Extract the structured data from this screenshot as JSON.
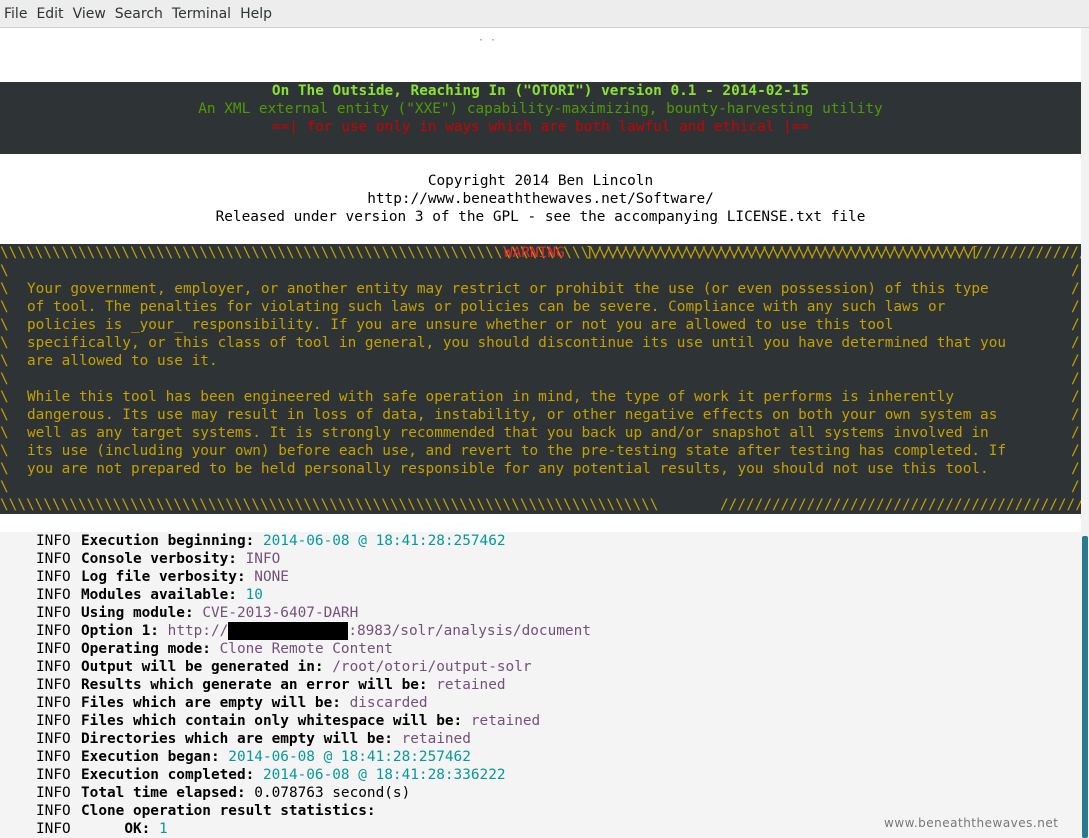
{
  "menu": [
    "File",
    "Edit",
    "View",
    "Search",
    "Terminal",
    "Help"
  ],
  "banner": {
    "title": "On The Outside, Reaching In (\"OTORI\") version 0.1 - 2014-02-15",
    "subtitle": "An XML external entity (\"XXE\") capability-maximizing, bounty-harvesting utility",
    "notice": "==| for use only in ways which are both lawful and ethical |=="
  },
  "copyright": {
    "line1": "Copyright 2014 Ben Lincoln",
    "line2": "http://www.beneaththewaves.net/Software/",
    "line3": "Released under version 3 of the GPL - see the accompanying LICENSE.txt file"
  },
  "warning": {
    "title": "WARNING",
    "para1": [
      "Your government, employer, or another entity may restrict or prohibit the use (or even possession) of this type",
      "of tool. The penalties for violating such laws or policies can be severe. Compliance with any such laws or",
      "policies is _your_ responsibility. If you are unsure whether or not you are allowed to use this tool",
      "specifically, or this class of tool in general, you should discontinue its use until you have determined that you",
      "are allowed to use it."
    ],
    "para2": [
      "While this tool has been engineered with safe operation in mind, the type of work it performs is inherently",
      "dangerous. Its use may result in loss of data, instability, or other negative effects on both your own system as",
      "well as any target systems. It is strongly recommended that you back up and/or snapshot all systems involved in",
      "its use (including your own) before each use, and revert to the pre-testing state after testing has completed. If",
      "you are not prepared to be held personally responsible for any potential results, you should not use this tool."
    ]
  },
  "log": {
    "level": "INFO",
    "rows": [
      {
        "label": "Execution beginning:",
        "value": "2014-06-08 @ 18:41:28:257462",
        "color": "teal"
      },
      {
        "label": "Console verbosity:",
        "value": "INFO",
        "color": "purple"
      },
      {
        "label": "Log file verbosity:",
        "value": "NONE",
        "color": "purple"
      },
      {
        "label": "Modules available:",
        "value": "10",
        "color": "teal"
      },
      {
        "label": "Using module:",
        "value": "CVE-2013-6407-DARH",
        "color": "purple"
      },
      {
        "label": "Option 1:",
        "value_prefix": "http://",
        "value_suffix": ":8983/solr/analysis/document",
        "color": "purple"
      },
      {
        "label": "Operating mode:",
        "value": "Clone Remote Content",
        "color": "purple"
      },
      {
        "label": "Output will be generated in:",
        "value": "/root/otori/output-solr",
        "color": "purple"
      },
      {
        "label": "Results which generate an error will be:",
        "value": "retained",
        "color": "purple"
      },
      {
        "label": "Files which are empty will be:",
        "value": "discarded",
        "color": "purple"
      },
      {
        "label": "Files which contain only whitespace will be:",
        "value": "retained",
        "color": "purple"
      },
      {
        "label": "Directories which are empty will be:",
        "value": "retained",
        "color": "purple"
      },
      {
        "label": "Execution began:",
        "value": "2014-06-08 @ 18:41:28:257462",
        "color": "teal"
      },
      {
        "label": "Execution completed:",
        "value": "2014-06-08 @ 18:41:28:336222",
        "color": "teal"
      },
      {
        "label": "Total time elapsed:",
        "value": "0.078763 second(s)",
        "color": "plain"
      },
      {
        "label": "Clone operation result statistics:",
        "value": "",
        "color": "plain"
      },
      {
        "label": "     OK:",
        "value": "1",
        "color": "teal"
      }
    ]
  },
  "watermark": "www.beneaththewaves.net"
}
